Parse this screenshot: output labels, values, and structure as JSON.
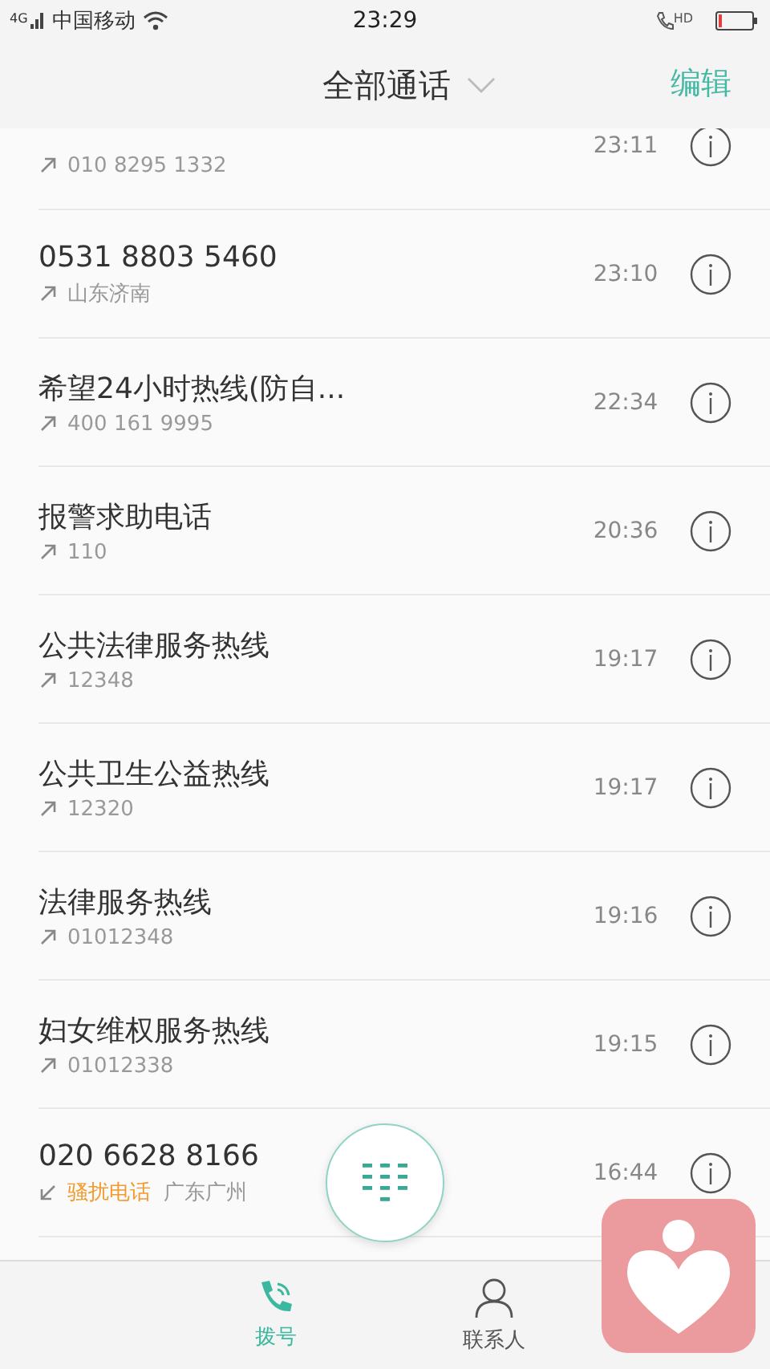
{
  "status_bar": {
    "network": "4G",
    "carrier": "中国移动",
    "time": "23:29",
    "call_badge": "HD"
  },
  "header": {
    "title": "全部通话",
    "edit": "编辑"
  },
  "calls": [
    {
      "kind": "outgoing",
      "number": "010 8295 1332",
      "time": "23:11"
    },
    {
      "name": "0531 8803 5460",
      "kind": "outgoing",
      "number": "山东济南",
      "time": "23:10"
    },
    {
      "name": "希望24小时热线(防自...",
      "kind": "outgoing",
      "number": "400 161 9995",
      "time": "22:34"
    },
    {
      "name": "报警求助电话",
      "kind": "outgoing",
      "number": "110",
      "time": "20:36"
    },
    {
      "name": "公共法律服务热线",
      "kind": "outgoing",
      "number": "12348",
      "time": "19:17"
    },
    {
      "name": "公共卫生公益热线",
      "kind": "outgoing",
      "number": "12320",
      "time": "19:17"
    },
    {
      "name": "法律服务热线",
      "kind": "outgoing",
      "number": "01012348",
      "time": "19:16"
    },
    {
      "name": "妇女维权服务热线",
      "kind": "outgoing",
      "number": "01012338",
      "time": "19:15"
    },
    {
      "name": "020 6628 8166",
      "kind": "incoming",
      "tag": "骚扰电话",
      "number": "广东广州",
      "time": "16:44"
    }
  ],
  "tabs": [
    {
      "label": "拨号",
      "kind": "dial",
      "selected": true
    },
    {
      "label": "联系人",
      "kind": "contacts",
      "selected": false
    }
  ]
}
